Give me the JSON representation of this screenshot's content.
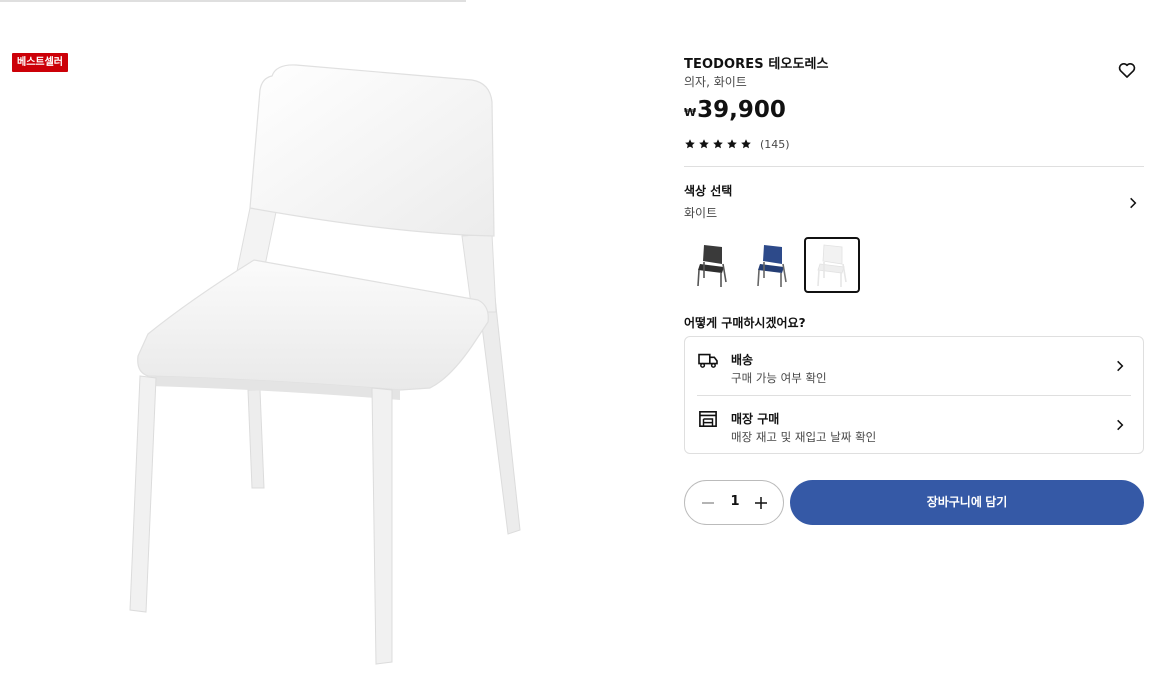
{
  "badge": "베스트셀러",
  "product": {
    "name": "TEODORES 테오도레스",
    "description": "의자, 화이트",
    "currency": "₩",
    "price": "39,900",
    "rating_stars": 5,
    "review_count": "(145)"
  },
  "color": {
    "title": "색상 선택",
    "value": "화이트",
    "swatches": [
      {
        "label": "블랙",
        "color": "#3a3a3a",
        "selected": false
      },
      {
        "label": "블루",
        "color": "#2d4a8a",
        "selected": false
      },
      {
        "label": "화이트",
        "color": "#f2f2f2",
        "selected": true
      }
    ]
  },
  "purchase": {
    "heading": "어떻게 구매하시겠어요?",
    "options": [
      {
        "icon": "delivery-truck-icon",
        "title": "배송",
        "subtitle": "구매 가능 여부 확인"
      },
      {
        "icon": "store-icon",
        "title": "매장 구매",
        "subtitle": "매장 재고 및 재입고 날짜 확인"
      }
    ]
  },
  "quantity": {
    "value": "1"
  },
  "cart_button": "장바구니에 담기",
  "colors": {
    "accent": "#3559a6",
    "badge": "#cc0008",
    "text": "#111111"
  }
}
